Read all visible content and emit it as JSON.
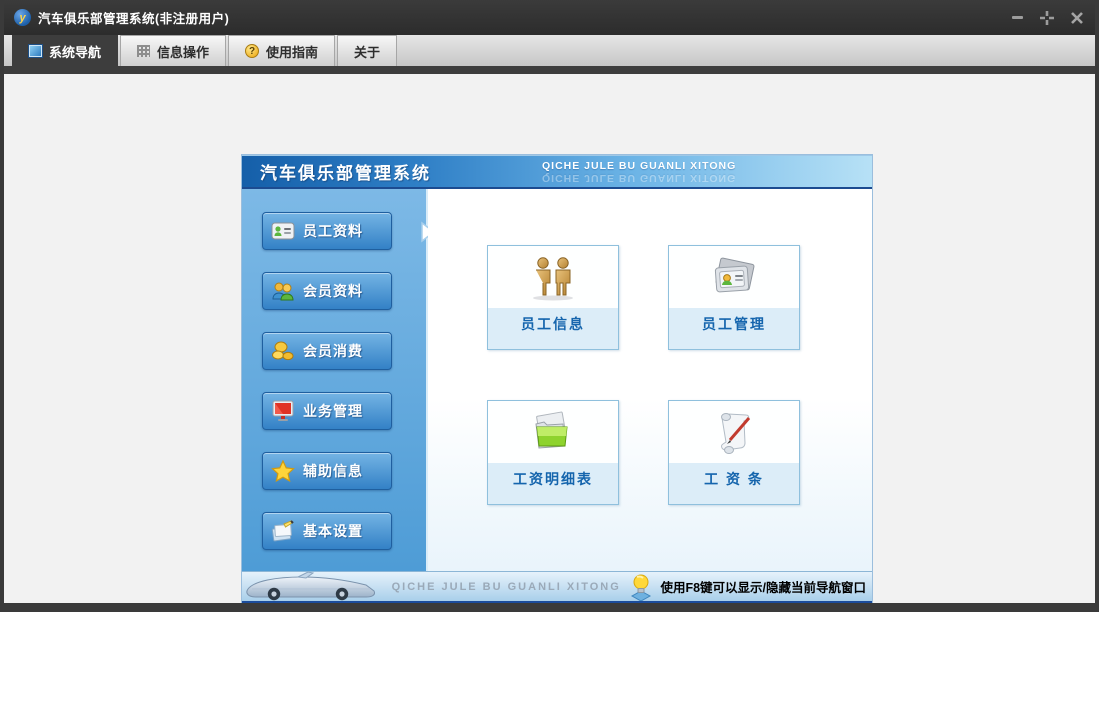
{
  "titlebar": {
    "title": "汽车俱乐部管理系统(非注册用户)",
    "logo_letter": "y",
    "controls": [
      {
        "name": "minimize-button",
        "icon": "minimize-icon"
      },
      {
        "name": "restore-button",
        "icon": "restore-icon"
      },
      {
        "name": "close-button",
        "icon": "close-icon"
      }
    ]
  },
  "tabs": [
    {
      "label": "系统导航",
      "icon": "blue-screen-icon",
      "active": true
    },
    {
      "label": "信息操作",
      "icon": "grid-icon",
      "active": false
    },
    {
      "label": "使用指南",
      "icon": "help-badge-icon",
      "active": false
    },
    {
      "label": "关于",
      "icon": null,
      "active": false
    }
  ],
  "panel": {
    "header": {
      "title": "汽车俱乐部管理系统",
      "subtitle": "QICHE JULE BU GUANLI XITONG"
    },
    "sidebar": {
      "items": [
        {
          "label": "员工资料",
          "icon": "id-card-icon",
          "active": true
        },
        {
          "label": "会员资料",
          "icon": "members-icon",
          "active": false
        },
        {
          "label": "会员消费",
          "icon": "coins-icon",
          "active": false
        },
        {
          "label": "业务管理",
          "icon": "monitor-icon",
          "active": false
        },
        {
          "label": "辅助信息",
          "icon": "star-icon",
          "active": false
        },
        {
          "label": "基本设置",
          "icon": "notebook-pen-icon",
          "active": false
        }
      ]
    },
    "tiles": [
      {
        "label": "员工信息",
        "icon": "two-people-icon"
      },
      {
        "label": "员工管理",
        "icon": "folder-card-icon"
      },
      {
        "label": "工资明细表",
        "icon": "green-folder-icon"
      },
      {
        "label": "工 资 条",
        "icon": "scroll-pen-icon"
      }
    ],
    "footer": {
      "brand": "QICHE JULE BU GUANLI XITONG",
      "hint": "使用F8键可以显示/隐藏当前导航窗口",
      "hint_icon": "lightbulb-icon",
      "image": "car-icon"
    }
  },
  "colors": {
    "titlebar_bg": "#333333",
    "active_tab_bg": "#3d3d3d",
    "header_blue_left": "#155fa9",
    "header_blue_right": "#b7e1f6",
    "sidebar_blue": "#5aa4da",
    "button_blue": "#3381c6",
    "tile_label_blue": "#1565ad",
    "footer_navy": "#1b4c9c"
  }
}
